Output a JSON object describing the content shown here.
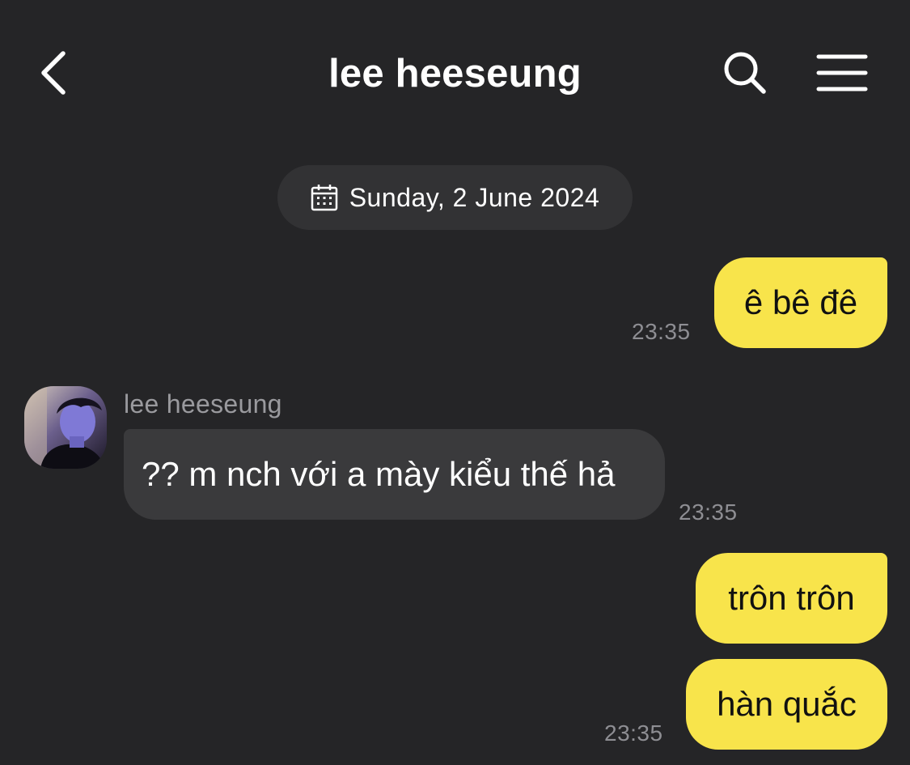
{
  "header": {
    "back_icon": "chevron-left-icon",
    "title": "lee heeseung",
    "search_icon": "search-icon",
    "menu_icon": "hamburger-menu-icon"
  },
  "date_divider": {
    "icon": "calendar-icon",
    "text": "Sunday, 2 June 2024"
  },
  "colors": {
    "background": "#252527",
    "my_bubble": "#f8e44b",
    "their_bubble": "#3a3a3c",
    "date_chip": "#323234",
    "timestamp": "#8e8e93"
  },
  "messages": [
    {
      "from": "me",
      "text": "ê bê đê",
      "time": "23:35"
    },
    {
      "from": "lee heeseung",
      "sender_name": "lee heeseung",
      "avatar": "profile-photo",
      "text": "?? m nch với a mày kiểu thế hả",
      "time": "23:35"
    },
    {
      "from": "me",
      "text": "trôn trôn"
    },
    {
      "from": "me",
      "text": "hàn quắc",
      "time": "23:35"
    }
  ]
}
